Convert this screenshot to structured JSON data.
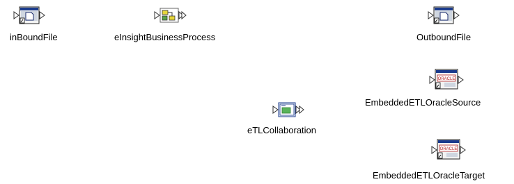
{
  "canvas": {
    "nodes": [
      {
        "id": "inbound",
        "label": "inBoundFile",
        "icon": "file-external-application-icon"
      },
      {
        "id": "bp",
        "label": "eInsightBusinessProcess",
        "icon": "business-process-icon"
      },
      {
        "id": "outbound",
        "label": "OutboundFile",
        "icon": "file-external-application-icon"
      },
      {
        "id": "etlsource",
        "label": "EmbeddedETLOracleSource",
        "icon": "oracle-external-application-icon",
        "icon_text": "ORACLE"
      },
      {
        "id": "etlcollab",
        "label": "eTLCollaboration",
        "icon": "etl-collaboration-icon"
      },
      {
        "id": "etltarget",
        "label": "EmbeddedETLOracleTarget",
        "icon": "oracle-external-application-icon",
        "icon_text": "ORACLE"
      }
    ]
  }
}
